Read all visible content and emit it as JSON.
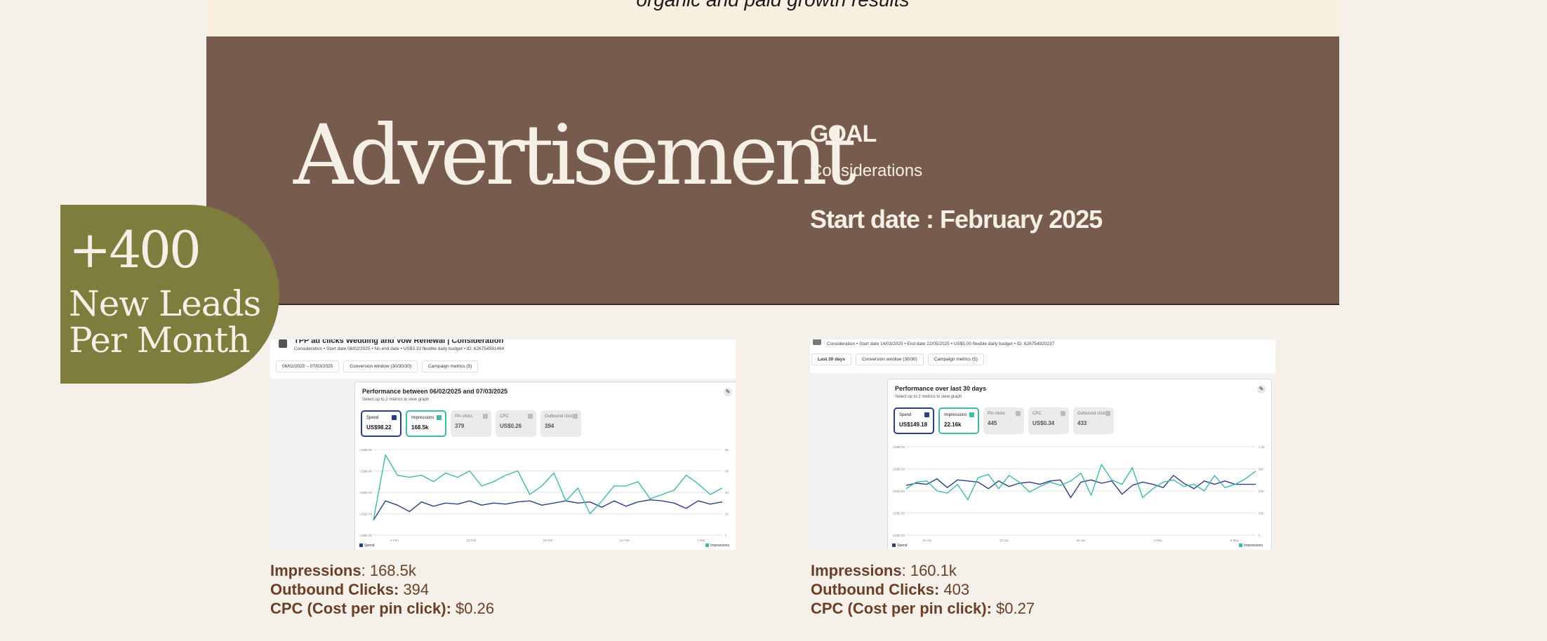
{
  "tagline": "organic and paid growth results",
  "hero": {
    "title": "Advertisement",
    "goal_label": "GOAL",
    "goal_value": "Considerations",
    "start_date": "Start date : February 2025"
  },
  "leads_badge": {
    "count": "+400",
    "line1": "New Leads",
    "line2": "Per Month",
    "color": "#7f7d3d"
  },
  "colors": {
    "hero_bg": "#775c4e",
    "page_bg": "#f5f1ea",
    "stats_text": "#6a3f26",
    "spend_series": "#2b3f86",
    "impressions_series": "#42b8a6"
  },
  "screenshot_left": {
    "campaign_title": "TPP ad clicks Wedding and Vow Renewal | Consideration",
    "meta": "Consideration • Start date 06/02/2025 • No end date • US$3.33 flexible daily budget • ID: 626754591484",
    "tabs": [
      "06/02/2025 – 07/03/2025",
      "Conversion window (30/30/30)",
      "Campaign metrics (5)"
    ],
    "card_title": "Performance between 06/02/2025 and 07/03/2025",
    "card_sub": "Select up to 2 metrics to view graph",
    "metrics": [
      {
        "label": "Spend",
        "value": "US$98.22",
        "state": "spend"
      },
      {
        "label": "Impressions",
        "value": "168.5k",
        "state": "imp"
      },
      {
        "label": "Pin clicks",
        "value": "379",
        "state": "off"
      },
      {
        "label": "CPC",
        "value": "US$0.26",
        "state": "off"
      },
      {
        "label": "Outbound clicks",
        "value": "394",
        "state": "off"
      }
    ],
    "x_ticks": [
      "6 Feb",
      "12 Feb",
      "18 Feb",
      "24 Feb",
      "2 Mar"
    ],
    "y_left_ticks": [
      "US$8.00",
      "US$6.00",
      "US$4.00",
      "US$2.00",
      "US$0.00"
    ],
    "y_right_ticks": [
      "8k",
      "6k",
      "4k",
      "2k",
      "0"
    ],
    "legend": [
      "Spend",
      "Impressions"
    ]
  },
  "screenshot_right": {
    "meta": "Consideration • Start date 14/03/2025 • End date 22/05/2025 • US$5.00 flexible daily budget • ID: 626754920237",
    "tabs": [
      "Last 30 days",
      "Conversion window (30/30)",
      "Campaign metrics (5)"
    ],
    "card_title": "Performance over last 30 days",
    "card_sub": "Select up to 2 metrics to view graph",
    "metrics": [
      {
        "label": "Spend",
        "value": "US$149.18",
        "state": "spend"
      },
      {
        "label": "Impressions",
        "value": "22.16k",
        "state": "imp"
      },
      {
        "label": "Pin clicks",
        "value": "445",
        "state": "off"
      },
      {
        "label": "CPC",
        "value": "US$0.34",
        "state": "off"
      },
      {
        "label": "Outbound clicks",
        "value": "433",
        "state": "off"
      }
    ],
    "x_ticks": [
      "18 Apr",
      "22 Apr",
      "26 Apr",
      "2 May",
      "8 May"
    ],
    "y_left_ticks": [
      "US$8.00",
      "US$6.00",
      "US$4.00",
      "US$2.00",
      "US$0.00"
    ],
    "y_right_ticks": [
      "1.2k",
      "800",
      "400",
      "200",
      "0"
    ],
    "legend": [
      "Spend",
      "Impressions"
    ]
  },
  "chart_data": [
    {
      "type": "line",
      "x": [
        1,
        2,
        3,
        4,
        5,
        6,
        7,
        8,
        9,
        10,
        11,
        12,
        13,
        14,
        15,
        16,
        17,
        18,
        19,
        20,
        21,
        22,
        23,
        24,
        25,
        26,
        27,
        28,
        29,
        30
      ],
      "series": [
        {
          "name": "Spend",
          "values": [
            1.4,
            3.2,
            2.8,
            2.2,
            3.1,
            2.7,
            3.0,
            2.9,
            3.2,
            2.8,
            3.0,
            2.9,
            3.1,
            3.2,
            2.8,
            3.0,
            3.2,
            3.0,
            3.1,
            2.6,
            3.2,
            2.7,
            3.1,
            3.3,
            3.2,
            3.0,
            2.5,
            3.2,
            2.9,
            3.1
          ],
          "color": "#2b3f86"
        },
        {
          "name": "Impressions",
          "values": [
            1.4,
            7.5,
            5.6,
            5.4,
            5.6,
            5.0,
            5.8,
            5.4,
            6.0,
            4.6,
            5.0,
            5.6,
            6.0,
            3.8,
            4.6,
            5.8,
            3.2,
            4.4,
            2.0,
            3.2,
            4.6,
            4.6,
            5.0,
            3.4,
            3.8,
            4.2,
            5.6,
            4.8,
            3.8,
            4.4
          ],
          "color": "#42b8a6"
        }
      ],
      "y_left": {
        "min": 0,
        "max": 8
      },
      "y_right": {
        "min": 0,
        "max": 8000
      }
    },
    {
      "type": "line",
      "x": [
        1,
        2,
        3,
        4,
        5,
        6,
        7,
        8,
        9,
        10,
        11,
        12,
        13,
        14,
        15,
        16,
        17,
        18,
        19,
        20,
        21,
        22,
        23,
        24,
        25,
        26,
        27,
        28,
        29,
        30,
        31,
        32,
        33,
        34,
        35
      ],
      "series": [
        {
          "name": "Spend",
          "values": [
            4.5,
            4.7,
            4.6,
            5.1,
            4.3,
            5.0,
            4.9,
            4.8,
            4.2,
            4.9,
            4.4,
            4.7,
            4.8,
            4.6,
            4.9,
            5.0,
            3.4,
            4.8,
            5.0,
            4.7,
            4.9,
            3.7,
            4.5,
            4.8,
            4.6,
            4.3,
            5.4,
            4.7,
            4.2,
            4.9,
            4.6,
            4.9,
            4.6,
            4.6,
            4.6
          ],
          "color": "#2b3f86"
        },
        {
          "name": "Impressions",
          "values": [
            4.2,
            4.8,
            4.9,
            4.0,
            3.8,
            4.6,
            3.2,
            5.2,
            5.5,
            4.2,
            5.4,
            4.8,
            3.9,
            4.4,
            4.8,
            4.5,
            4.9,
            5.6,
            3.6,
            6.4,
            5.0,
            4.6,
            6.1,
            3.4,
            4.2,
            4.8,
            5.0,
            4.4,
            4.6,
            4.0,
            5.4,
            4.3,
            4.6,
            5.1,
            5.8
          ],
          "color": "#42b8a6"
        }
      ],
      "y_left": {
        "min": 0,
        "max": 8
      },
      "y_right": {
        "min": 0,
        "max": 1200
      }
    }
  ],
  "stats_left": {
    "impressions_label": "Impressions",
    "impressions_value": ": 168.5k",
    "outbound_label": "Outbound Clicks:",
    "outbound_value": " 394",
    "cpc_label": "CPC (Cost per pin click):",
    "cpc_value": " $0.26"
  },
  "stats_right": {
    "impressions_label": "Impressions",
    "impressions_value": ": 160.1k",
    "outbound_label": "Outbound Clicks:",
    "outbound_value": " 403",
    "cpc_label": "CPC (Cost per pin click):",
    "cpc_value": " $0.27"
  }
}
